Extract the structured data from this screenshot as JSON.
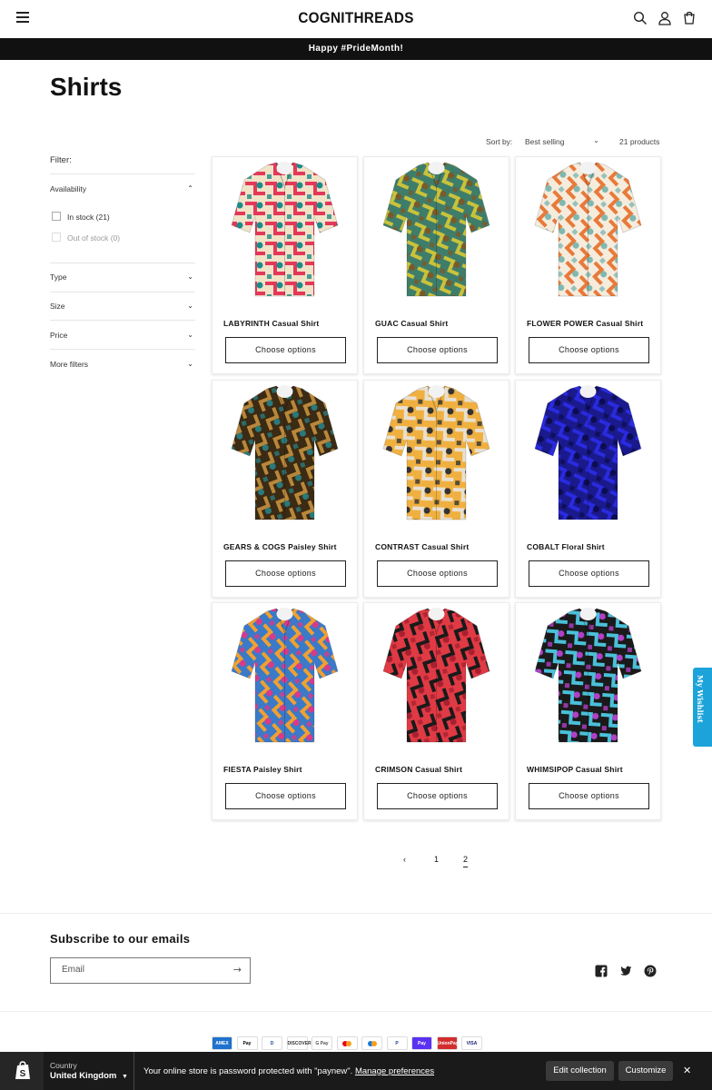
{
  "header": {
    "logo": "COGNITHREADS",
    "icons": [
      "menu-icon",
      "search-icon",
      "account-icon",
      "cart-icon"
    ]
  },
  "announcement": "Happy #PrideMonth!",
  "collection": {
    "title": "Shirts",
    "sort_label": "Sort by:",
    "sort_value": "Best selling",
    "product_count": "21 products"
  },
  "filters": {
    "label": "Filter:",
    "availability": "Availability",
    "in_stock": "In stock (21)",
    "out_of_stock": "Out of stock (0)",
    "type": "Type",
    "size": "Size",
    "price": "Price",
    "more": "More filters"
  },
  "products": [
    {
      "name": "LABYRINTH Casual Shirt",
      "button": "Choose options",
      "colors": [
        "#f0e3c8",
        "#e4385a",
        "#1a8c8c"
      ]
    },
    {
      "name": "GUAC Casual Shirt",
      "button": "Choose options",
      "colors": [
        "#3f7d6b",
        "#c9c23a",
        "#7a5a2a"
      ]
    },
    {
      "name": "FLOWER POWER Casual Shirt",
      "button": "Choose options",
      "colors": [
        "#f5ecdd",
        "#e87a3a",
        "#7fb8b0"
      ]
    },
    {
      "name": "GEARS & COGS Paisley Shirt",
      "button": "Choose options",
      "colors": [
        "#3b2a14",
        "#b8873a",
        "#2a7a7a"
      ]
    },
    {
      "name": "CONTRAST Casual Shirt",
      "button": "Choose options",
      "colors": [
        "#f0b040",
        "#e8e0d0",
        "#333333"
      ]
    },
    {
      "name": "COBALT Floral Shirt",
      "button": "Choose options",
      "colors": [
        "#1a1a8c",
        "#2a2ae0",
        "#0c0c50"
      ]
    },
    {
      "name": "FIESTA Paisley Shirt",
      "button": "Choose options",
      "colors": [
        "#3a7ac8",
        "#f0a030",
        "#d83a8a"
      ]
    },
    {
      "name": "CRIMSON Casual Shirt",
      "button": "Choose options",
      "colors": [
        "#e03a44",
        "#1a1a1a",
        "#a82030"
      ]
    },
    {
      "name": "WHIMSIPOP Casual Shirt",
      "button": "Choose options",
      "colors": [
        "#1a1a1a",
        "#4ac0d8",
        "#b040c8"
      ]
    }
  ],
  "pagination": {
    "prev": "‹",
    "page1": "1",
    "page2": "2",
    "current": 2
  },
  "newsletter": {
    "title": "Subscribe to our emails",
    "placeholder": "Email",
    "submit": "→"
  },
  "social": [
    "facebook-icon",
    "twitter-icon",
    "pinterest-icon"
  ],
  "payments": [
    "AMEX",
    "Pay",
    "D",
    "DISCOVER",
    "G Pay",
    "",
    "",
    "P",
    "Pay",
    "UnionPay",
    "VISA"
  ],
  "admin_bar": {
    "country_label": "Country",
    "country_value": "United Kingdom",
    "message": "Your online store is password protected with \"paynew\".",
    "manage_link": "Manage preferences",
    "edit_button": "Edit collection",
    "customize_button": "Customize",
    "close": "✕"
  },
  "wishlist": "My Wishlist"
}
